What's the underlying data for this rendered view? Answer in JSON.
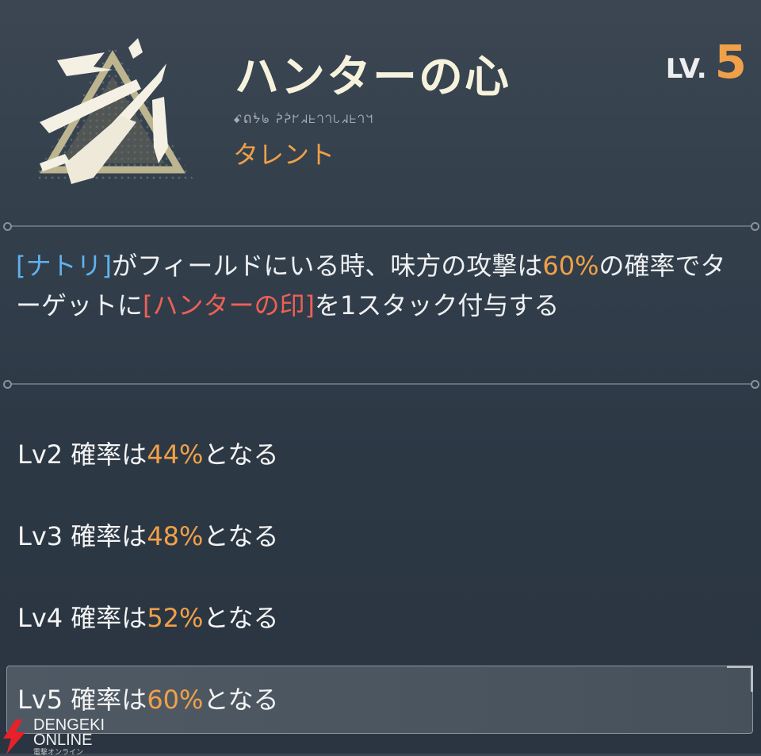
{
  "header": {
    "title": "ハンターの心",
    "level_label": "LV.",
    "level_value": "5",
    "glyph_text": "ꗃᕠᖭᖚ ᕉᕉᖸᖽᖶᘃᘃᘂᖽᖶᘃᖻ",
    "subtitle": "タレント",
    "icon": "hunter-talent-icon"
  },
  "description": {
    "parts": [
      {
        "text": "[ナトリ]",
        "color": "blue"
      },
      {
        "text": "がフィールドにいる時、味方の攻撃は",
        "color": "white"
      },
      {
        "text": "60%",
        "color": "orange"
      },
      {
        "text": "の確率でターゲットに",
        "color": "white"
      },
      {
        "text": "[ハンターの印]",
        "color": "red"
      },
      {
        "text": "を1スタック付与する",
        "color": "white"
      }
    ]
  },
  "levels": [
    {
      "prefix": "Lv2 確率は",
      "value": "44%",
      "suffix": "となる"
    },
    {
      "prefix": "Lv3 確率は",
      "value": "48%",
      "suffix": "となる"
    },
    {
      "prefix": "Lv4 確率は",
      "value": "52%",
      "suffix": "となる"
    },
    {
      "prefix": "Lv5 確率は",
      "value": "60%",
      "suffix": "となる"
    }
  ],
  "active_level_index": 3,
  "watermark": {
    "line1": "DENGEKI",
    "line2": "ONLINE",
    "line3": "電撃オンライン"
  },
  "colors": {
    "accent_orange": "#f0a048",
    "link_blue": "#5fb2ee",
    "mark_red": "#ee6055"
  }
}
